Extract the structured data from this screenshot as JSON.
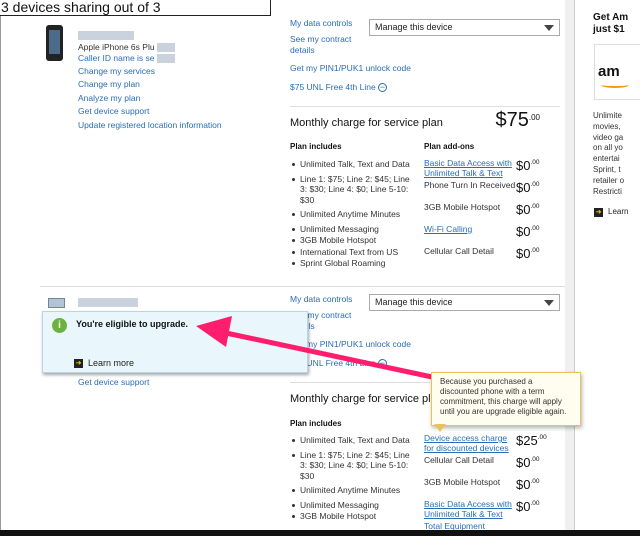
{
  "page": {
    "title": "3 devices sharing out of 3"
  },
  "devices": [
    {
      "model": "Apple iPhone 6s Plu",
      "caller_id": "Caller ID name is se",
      "menu": [
        "Change my services",
        "Change my plan",
        "Analyze my plan",
        "Get device support",
        "Update registered location information"
      ],
      "controls": [
        "My data controls",
        "See my contract",
        "details",
        "Get my PIN1/PUK1 unlock code",
        "$75 UNL Free 4th Line"
      ],
      "select_value": "Manage this device",
      "plan_label": "Monthly charge for service plan",
      "price": {
        "dollars": "75",
        "cents": ".00"
      },
      "includes_header": "Plan includes",
      "includes": [
        "Unlimited Talk, Text and Data",
        "Line 1: $75; Line 2: $45; Line 3: $30; Line 4: $0; Line 5-10: $30",
        "Unlimited Anytime Minutes",
        "Unlimited Messaging",
        "3GB Mobile Hotspot",
        "International Text from US",
        "Sprint Global Roaming"
      ],
      "addons_header": "Plan add-ons",
      "addons": [
        {
          "name": "Basic Data Access with Unlimited Talk & Text",
          "amount": "0",
          "cents": ".00",
          "link": true
        },
        {
          "name": "Phone Turn In Received",
          "amount": "0",
          "cents": ".00",
          "link": false
        },
        {
          "name": "3GB Mobile Hotspot",
          "amount": "0",
          "cents": ".00",
          "link": false
        },
        {
          "name": "Wi-Fi Calling",
          "amount": "0",
          "cents": ".00",
          "link": true
        },
        {
          "name": "Cellular Call Detail",
          "amount": "0",
          "cents": ".00",
          "link": false
        }
      ]
    },
    {
      "menu": [
        "Get device support"
      ],
      "controls": [
        "My data controls",
        "See my contract",
        "details",
        "Get my PIN1/PUK1 unlock code",
        "$75 UNL Free 4th Line"
      ],
      "select_value": "Manage this device",
      "upgrade": {
        "text": "You're eligible to upgrade.",
        "learn_more": "Learn more"
      },
      "plan_label": "Monthly charge for service plan",
      "includes_header": "Plan includes",
      "includes": [
        "Unlimited Talk, Text and Data",
        "Line 1: $75; Line 2: $45; Line 3: $30; Line 4: $0; Line 5-10: $30",
        "Unlimited Anytime Minutes",
        "Unlimited Messaging",
        "3GB Mobile Hotspot"
      ],
      "addons": [
        {
          "name": "Device access charge for discounted devices",
          "amount": "25",
          "cents": ".00",
          "link": true
        },
        {
          "name": "Cellular Call Detail",
          "amount": "0",
          "cents": ".00",
          "link": false
        },
        {
          "name": "3GB Mobile Hotspot",
          "amount": "0",
          "cents": ".00",
          "link": false
        },
        {
          "name": "Basic Data Access with Unlimited Talk & Text",
          "amount": "0",
          "cents": ".00",
          "link": true
        },
        {
          "name": "Total Equipment",
          "amount": "",
          "cents": "",
          "link": true
        }
      ],
      "tooltip": "Because you purchased a discounted phone with a term commitment, this charge will apply until you are upgrade eligible again."
    }
  ],
  "ad": {
    "title_line1": "Get Am",
    "title_line2": "just $1",
    "logo": "am",
    "body": [
      "Unlimite",
      "movies,",
      "video ga",
      "on all yo",
      "entertai",
      "Sprint, t",
      "retailer o",
      "Restricti"
    ],
    "learn": "Learn"
  }
}
